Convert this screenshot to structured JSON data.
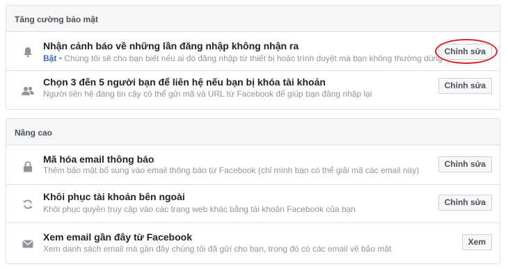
{
  "security_section": {
    "title": "Tăng cường bảo mật",
    "rows": [
      {
        "title": "Nhận cảnh báo về những lần đăng nhập không nhận ra",
        "status": "Bật",
        "separator": "•",
        "description": "Chúng tôi sẽ cho bạn biết nếu ai đó đăng nhập từ thiết bị hoặc trình duyệt mà bạn không thường dùng",
        "button": "Chỉnh sửa",
        "icon": "bell-icon"
      },
      {
        "title": "Chọn 3 đến 5 người bạn để liên hệ nếu bạn bị khóa tài khoản",
        "description": "Người liên hệ đáng tin cậy có thể gửi mã và URL từ Facebook để giúp bạn đăng nhập lại",
        "button": "Chỉnh sửa",
        "icon": "friends-icon"
      }
    ]
  },
  "advanced_section": {
    "title": "Nâng cao",
    "rows": [
      {
        "title": "Mã hóa email thông báo",
        "description": "Thêm bảo mật bổ sung vào email thông báo từ Facebook (chỉ mình bạn có thể giải mã các email này)",
        "button": "Chỉnh sửa",
        "icon": "lock-icon"
      },
      {
        "title": "Khôi phục tài khoản bên ngoài",
        "description": "Khôi phục quyền truy cập vào các trang web khác bằng tài khoản Facebook của bạn",
        "button": "Chỉnh sửa",
        "icon": "refresh-icon"
      },
      {
        "title": "Xem email gần đây từ Facebook",
        "description": "Xem danh sách email mà gần đây chúng tôi đã gửi cho bạn, trong đó có các email về bảo mật",
        "button": "Xem",
        "icon": "envelope-icon"
      }
    ]
  },
  "colors": {
    "header_bg": "#f6f7f9",
    "border": "#dddfe2",
    "status_on": "#4267b2",
    "annotation_ring": "#d8232a"
  }
}
